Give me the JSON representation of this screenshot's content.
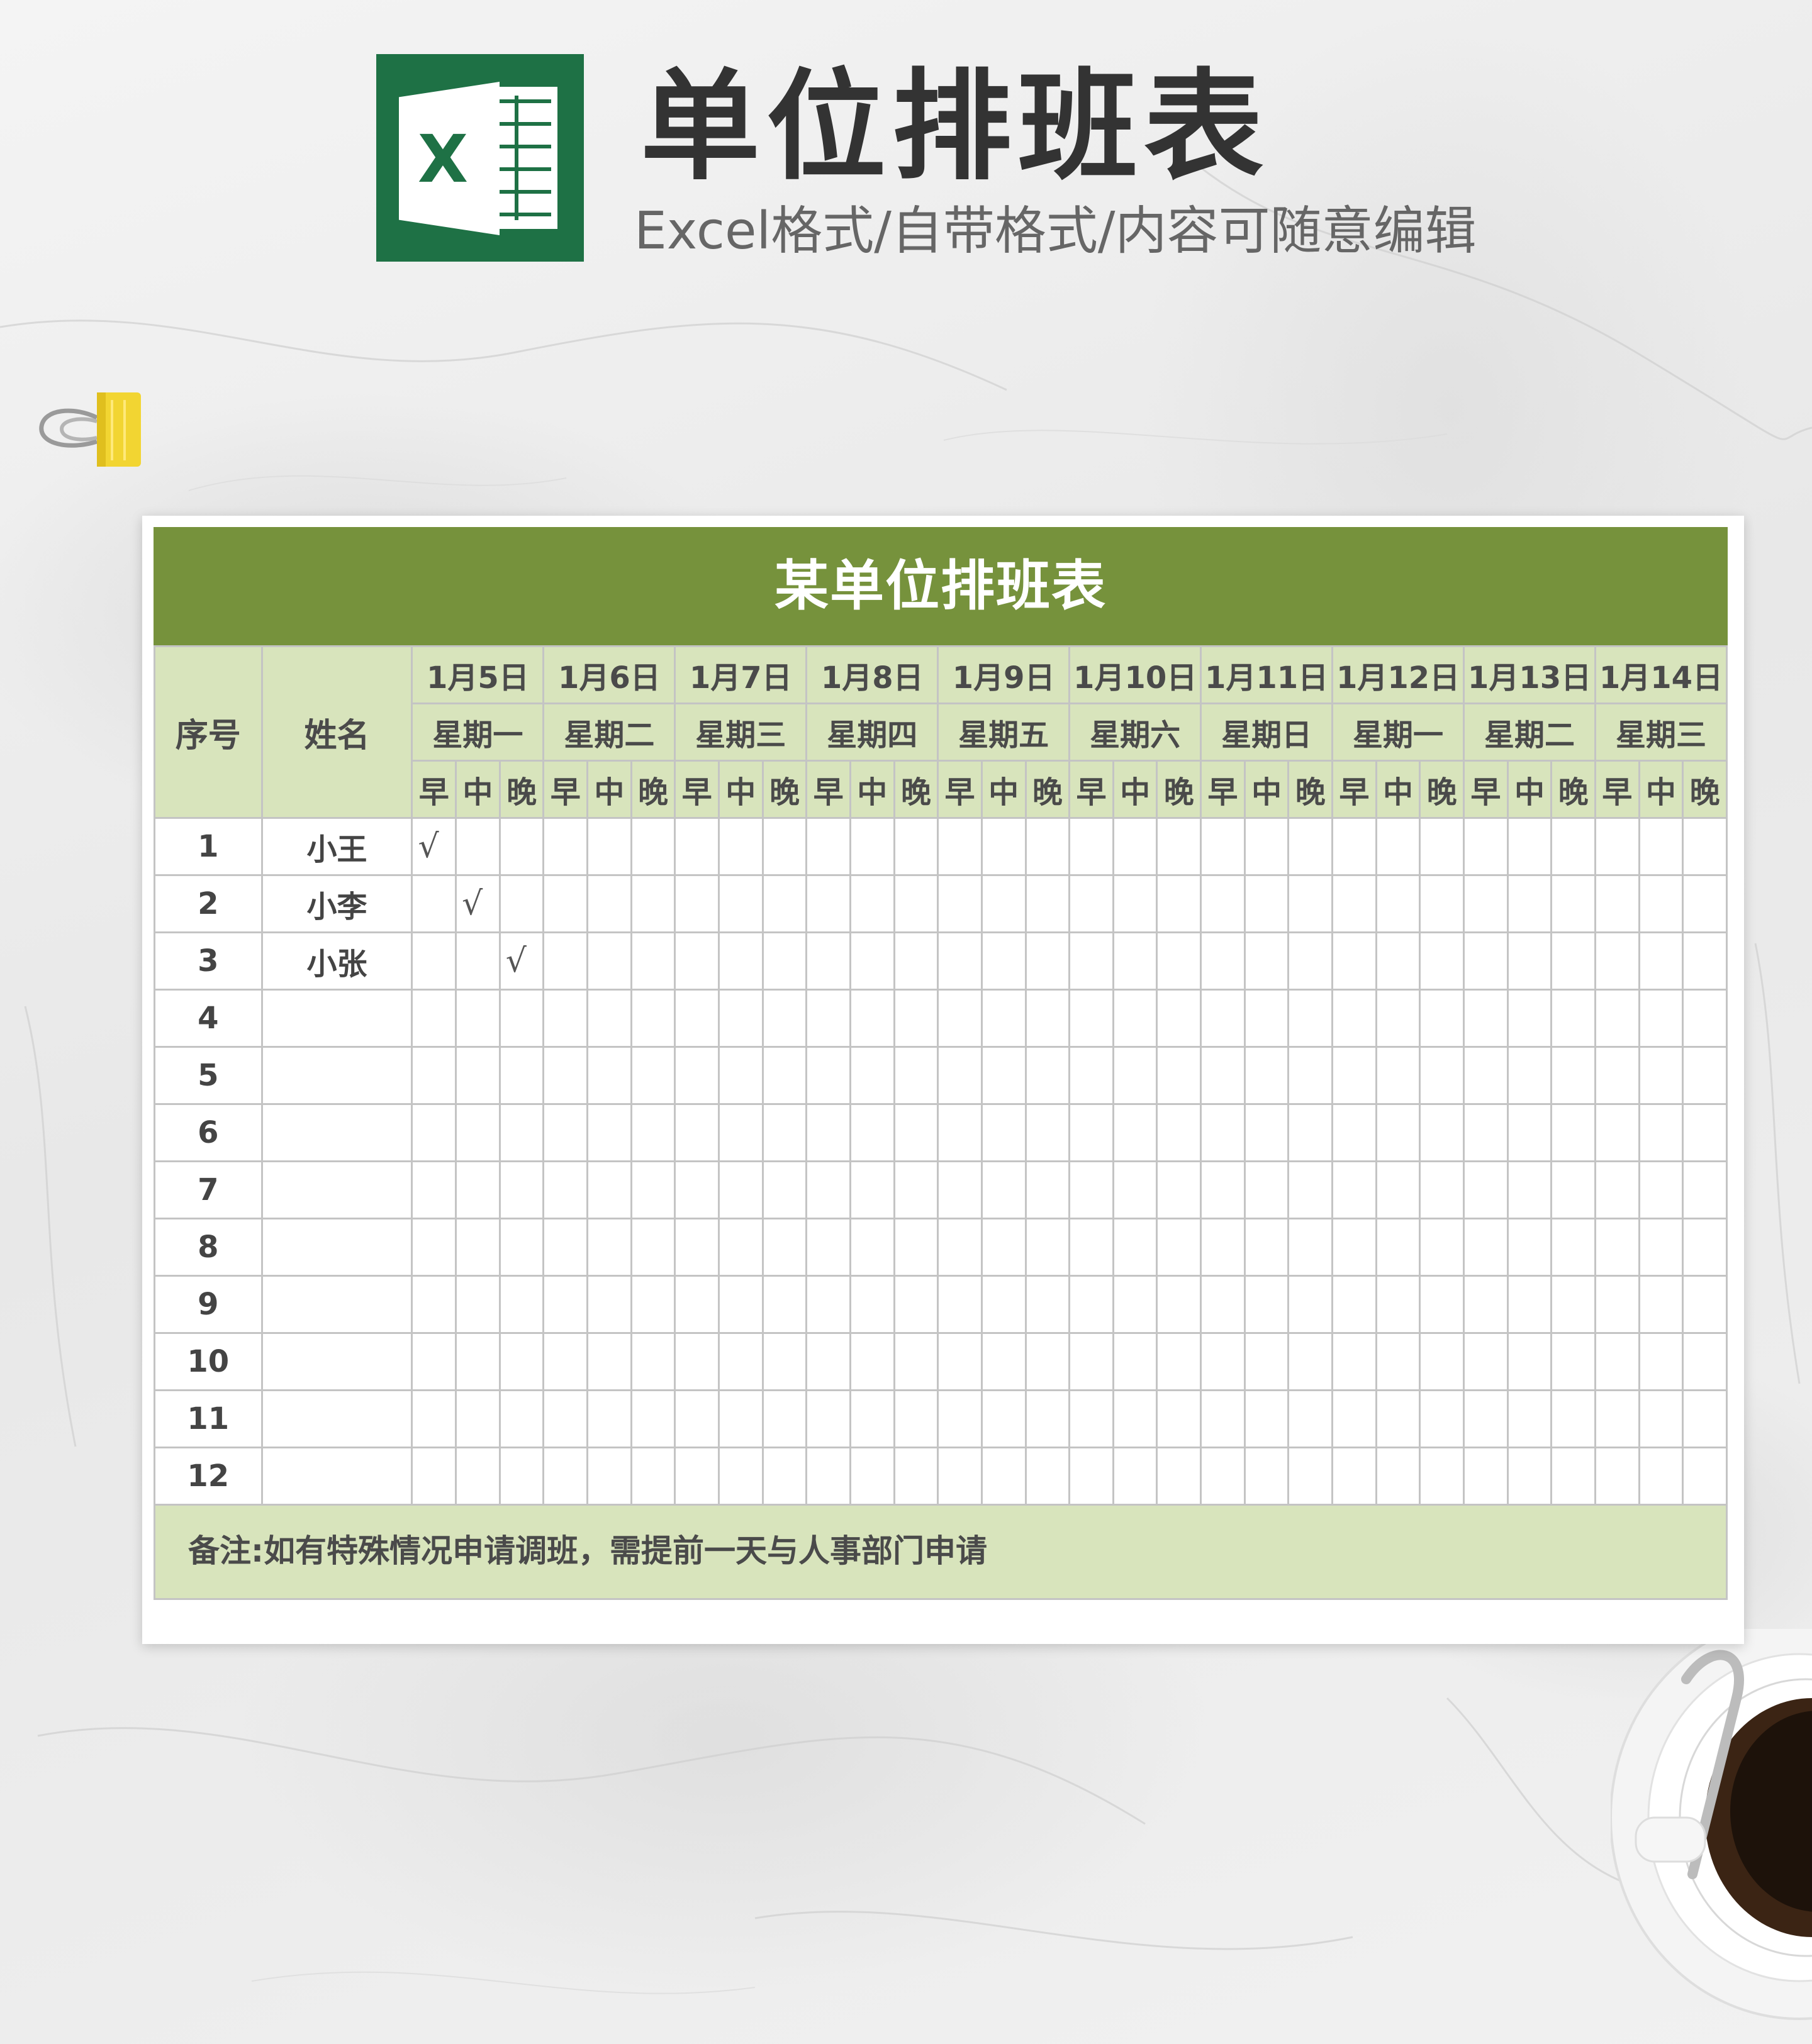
{
  "header": {
    "title": "单位排班表",
    "subtitle": "Excel格式/自带格式/内容可随意编辑",
    "logo_letter": "X"
  },
  "colors": {
    "logo_green": "#1e7145",
    "title_bar": "#76923c",
    "header_fill": "#d8e4bc",
    "grid_line": "#c4c4c4"
  },
  "icons": {
    "logo": "excel-logo-icon",
    "clip": "binder-clip-icon",
    "cup": "coffee-cup-icon"
  },
  "sheet": {
    "title": "某单位排班表",
    "col_seq": "序号",
    "col_name": "姓名",
    "shifts": [
      "早",
      "中",
      "晚"
    ],
    "days": [
      {
        "date": "1月5日",
        "weekday": "星期一"
      },
      {
        "date": "1月6日",
        "weekday": "星期二"
      },
      {
        "date": "1月7日",
        "weekday": "星期三"
      },
      {
        "date": "1月8日",
        "weekday": "星期四"
      },
      {
        "date": "1月9日",
        "weekday": "星期五"
      },
      {
        "date": "1月10日",
        "weekday": "星期六"
      },
      {
        "date": "1月11日",
        "weekday": "星期日"
      },
      {
        "date": "1月12日",
        "weekday": "星期一"
      },
      {
        "date": "1月13日",
        "weekday": "星期二"
      },
      {
        "date": "1月14日",
        "weekday": "星期三"
      }
    ],
    "rows": [
      {
        "seq": "1",
        "name": "小王",
        "marks": {
          "0": "√"
        }
      },
      {
        "seq": "2",
        "name": "小李",
        "marks": {
          "1": "√"
        }
      },
      {
        "seq": "3",
        "name": "小张",
        "marks": {
          "2": "√"
        }
      },
      {
        "seq": "4",
        "name": "",
        "marks": {}
      },
      {
        "seq": "5",
        "name": "",
        "marks": {}
      },
      {
        "seq": "6",
        "name": "",
        "marks": {}
      },
      {
        "seq": "7",
        "name": "",
        "marks": {}
      },
      {
        "seq": "8",
        "name": "",
        "marks": {}
      },
      {
        "seq": "9",
        "name": "",
        "marks": {}
      },
      {
        "seq": "10",
        "name": "",
        "marks": {}
      },
      {
        "seq": "11",
        "name": "",
        "marks": {}
      },
      {
        "seq": "12",
        "name": "",
        "marks": {}
      }
    ],
    "note": "备注:如有特殊情况申请调班，需提前一天与人事部门申请"
  }
}
